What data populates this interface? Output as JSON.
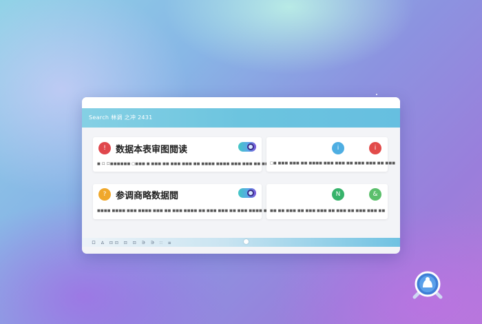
{
  "header": {
    "search_label": "Search 林调 之冲 2431"
  },
  "cards": [
    {
      "title": "数据本表审图閲读",
      "icon_char": "!",
      "icon_color": "#e0474c",
      "subtext": "■ ロ 口■■■■■■ □■■■ ■ ■■■ ■■ ■■■ ■■■ ■■ ■■■■ ■■■■ ■■■ ■■■ ■■ ■■■ ■■ ■■■ ■■■ ■■ ■■■"
    },
    {
      "title": "",
      "icon_left_color": "#4eaee2",
      "icon_right_color": "#e24b4a",
      "icon_left_char": "i",
      "icon_right_char": "i",
      "subtext": "□■ ■■■ ■■■ ■■ ■■■■ ■■■ ■■■ ■■ ■■■ ■■■ ■■ ■■■"
    },
    {
      "title": "参调商略数据閲",
      "icon_char": "?",
      "icon_color": "#f0a82c",
      "subtext": "■■■■ ■■■■ ■■■ ■■■■ ■■■ ■■ ■■■ ■■■■ ■■ ■■■ ■■■ ■■ ■■■ ■■■■ ■■ ■■■ ■■■ ■■■ ■■"
    },
    {
      "title": "",
      "icon_left_color": "#37b36b",
      "icon_right_color": "#5bbf6b",
      "icon_left_char": "N",
      "icon_right_char": "&",
      "subtext": "■■ ■■ ■■■ ■■ ■■■ ■■■ ■■ ■■■ ■■ ■■■ ■■■ ■■"
    }
  ],
  "bottombar": {
    "text": "ロ ∆ ⊡⊡ ⊡ ⊡ ∋ ∋ ∷ ≡"
  },
  "colors": {
    "header_accent": "#6cc4df",
    "fab_accent": "#3f7fd6"
  }
}
